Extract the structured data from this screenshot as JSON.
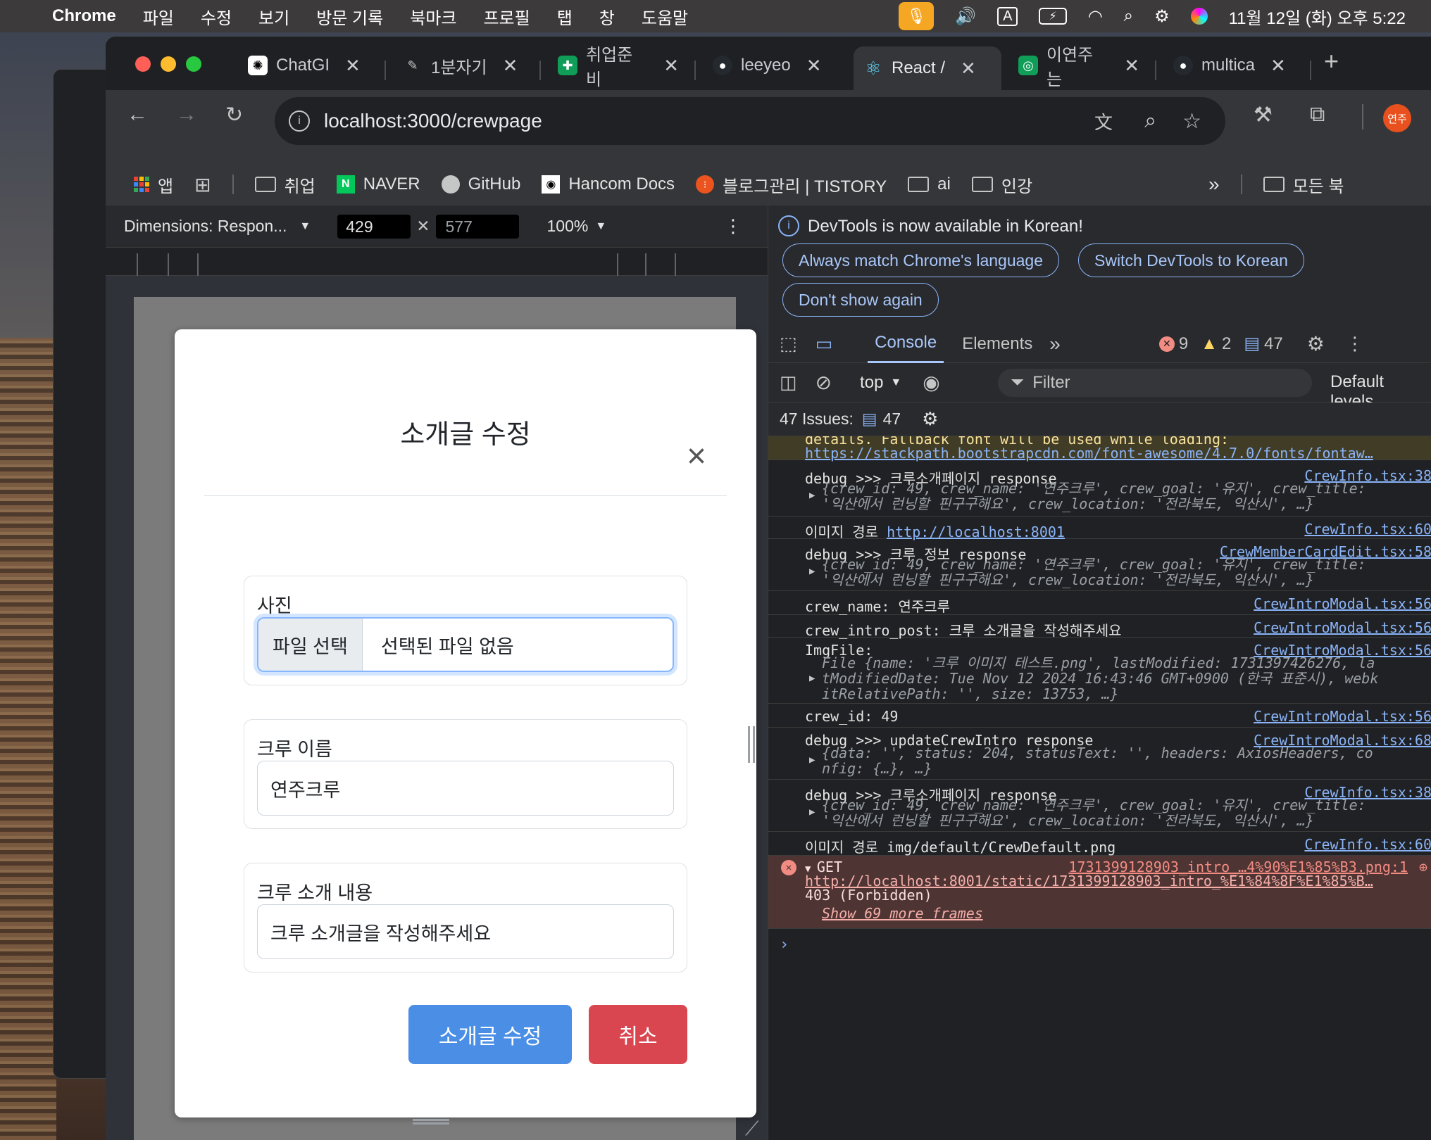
{
  "menubar": {
    "app": "Chrome",
    "items": [
      "파일",
      "수정",
      "보기",
      "방문 기록",
      "북마크",
      "프로필",
      "탭",
      "창",
      "도움말"
    ],
    "clock": "11월 12일 (화) 오후 5:22"
  },
  "tabs": [
    {
      "label": "ChatGI",
      "color": "#ffffff"
    },
    {
      "label": "1분자기",
      "color": "#5f6368"
    },
    {
      "label": "취업준비",
      "color": "#0f9d58"
    },
    {
      "label": "leeyeo",
      "color": "#24292f"
    },
    {
      "label": "React /",
      "color": "#61dafb",
      "active": true
    },
    {
      "label": "이연주는",
      "color": "#0f9d58"
    },
    {
      "label": "multica",
      "color": "#24292f"
    }
  ],
  "omnibox": {
    "url": "localhost:3000/crewpage"
  },
  "profile_badge": "연주",
  "bookmarks": [
    "앱",
    "취업",
    "NAVER",
    "GitHub",
    "Hancom Docs",
    "블로그관리 | TISTORY",
    "ai",
    "인강",
    "모든 북"
  ],
  "device_toolbar": {
    "dimensions": "Dimensions: Respon...",
    "width": "429",
    "height": "577",
    "zoom": "100%"
  },
  "modal": {
    "title": "소개글 수정",
    "photo_label": "사진",
    "file_button": "파일 선택",
    "file_status": "선택된 파일 없음",
    "crew_name_label": "크루 이름",
    "crew_name_value": "연주크루",
    "intro_label": "크루 소개 내용",
    "intro_value": "크루 소개글을 작성해주세요",
    "submit": "소개글 수정",
    "cancel": "취소"
  },
  "devtools": {
    "notice": "DevTools is now available in Korean!",
    "btn_match": "Always match Chrome's language",
    "btn_switch": "Switch DevTools to Korean",
    "btn_dont": "Don't show again",
    "tab_console": "Console",
    "tab_elements": "Elements",
    "errors": "9",
    "warnings": "2",
    "messages": "47",
    "context": "top",
    "filter": "Filter",
    "levels": "Default levels",
    "issues_label": "47 Issues:",
    "issues_count": "47"
  },
  "console": {
    "warn_text": "details. Fallback font will be used while loading:",
    "warn_link": "https://stackpath.bootstrapcdn.com/font-awesome/4.7.0/fonts/fontaw…",
    "rows": [
      {
        "msg": "debug >>> 크루소개페이지 response",
        "src": "CrewInfo.tsx:38"
      },
      {
        "msg": "이미지 경로 ",
        "link": "http://localhost:8001",
        "src": "CrewInfo.tsx:60"
      },
      {
        "msg": "debug >>> 크루 정보 response",
        "src": "CrewMemberCardEdit.tsx:58"
      },
      {
        "msg": "crew_name: 연주크루",
        "src": "CrewIntroModal.tsx:56"
      },
      {
        "msg": "crew_intro_post: 크루 소개글을 작성해주세요",
        "src": "CrewIntroModal.tsx:56"
      },
      {
        "msg": "ImgFile:",
        "src": "CrewIntroModal.tsx:56"
      },
      {
        "msg": "crew_id: 49",
        "src": "CrewIntroModal.tsx:56"
      },
      {
        "msg": "debug >>> updateCrewIntro response",
        "src": "CrewIntroModal.tsx:68"
      },
      {
        "msg": "debug >>> 크루소개페이지 response",
        "src": "CrewInfo.tsx:38"
      },
      {
        "msg": "이미지 경로 img/default/CrewDefault.png",
        "src": "CrewInfo.tsx:60"
      }
    ],
    "obj_crew_1": "{crew_id: 49, crew_name: '연주크루', crew_goal: '유지', crew_title:",
    "obj_crew_2": "'익산에서 런닝할 핀구구해요', crew_location: '전라북도, 익산시', …}",
    "obj_file_1": "File {name: '크루 이미지 테스트.png', lastModified: 1731397426276, la",
    "obj_file_2": "tModifiedDate: Tue Nov 12 2024 16:43:46 GMT+0900 (한국 표준시), webk",
    "obj_file_3": "itRelativePath: '', size: 13753, …}",
    "obj_axios_1": "{data: '', status: 204, statusText: '', headers: AxiosHeaders, co",
    "obj_axios_2": "nfig: {…}, …}",
    "err_method": "GET",
    "err_src": "1731399128903_intro_…4%90%E1%85%B3.png:1",
    "err_url": "http://localhost:8001/static/1731399128903_intro_%E1%84%8F%E1%85%B…",
    "err_status": "403 (Forbidden)",
    "err_more": "Show 69 more frames"
  }
}
